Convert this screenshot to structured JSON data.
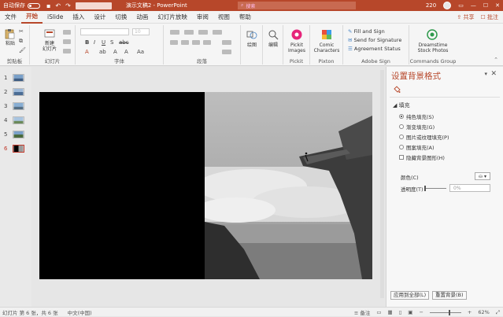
{
  "titlebar": {
    "autosave_label": "自动保存",
    "autosave_state": "关",
    "doc_title": "演示文稿2 - PowerPoint",
    "search_placeholder": "搜索",
    "user_number": "220"
  },
  "menu": {
    "tabs": [
      "文件",
      "开始",
      "iSlide",
      "插入",
      "设计",
      "切换",
      "动画",
      "幻灯片放映",
      "审阅",
      "视图",
      "帮助"
    ],
    "active_tab": "开始",
    "share_label": "共享",
    "comments_label": "批注"
  },
  "ribbon": {
    "clipboard": {
      "paste_label": "粘贴",
      "group_label": "剪贴板"
    },
    "slides": {
      "new_slide_label": "新建\n幻灯片",
      "group_label": "幻灯片"
    },
    "font": {
      "group_label": "字体",
      "size_value": "10"
    },
    "paragraph": {
      "group_label": "段落"
    },
    "drawing": {
      "label": "绘图"
    },
    "editing": {
      "label": "编辑"
    },
    "pickit": {
      "button_label": "Pickit\nImages",
      "group_label": "Pickit"
    },
    "pixton": {
      "button_label": "Comic\nCharacters",
      "group_label": "Pixton"
    },
    "adobe": {
      "items": [
        "Fill and Sign",
        "Send for Signature",
        "Agreement Status"
      ],
      "group_label": "Adobe Sign"
    },
    "commands": {
      "button_label": "Dreamstime\nStock Photos",
      "group_label": "Commands Group"
    }
  },
  "thumbnails": {
    "numbers": [
      "1",
      "2",
      "3",
      "4",
      "5",
      "6"
    ],
    "active_index": 5
  },
  "pane": {
    "title": "设置背景格式",
    "section_label": "填充",
    "options": [
      "纯色填充(S)",
      "渐变填充(G)",
      "图片或纹理填充(P)",
      "图案填充(A)"
    ],
    "selected_option": 0,
    "hide_bg_label": "隐藏背景图形(H)",
    "color_label": "颜色(C)",
    "transparency_label": "透明度(T)",
    "transparency_value": "0%",
    "apply_all_label": "应用到全部(L)",
    "reset_label": "重置背景(B)"
  },
  "status": {
    "slide_info": "幻灯片 第 6 张，共 6 张",
    "language": "中文(中国)",
    "notes_label": "备注",
    "zoom": "62%"
  },
  "colors": {
    "accent": "#b7472a",
    "slide_left": "#000000"
  }
}
